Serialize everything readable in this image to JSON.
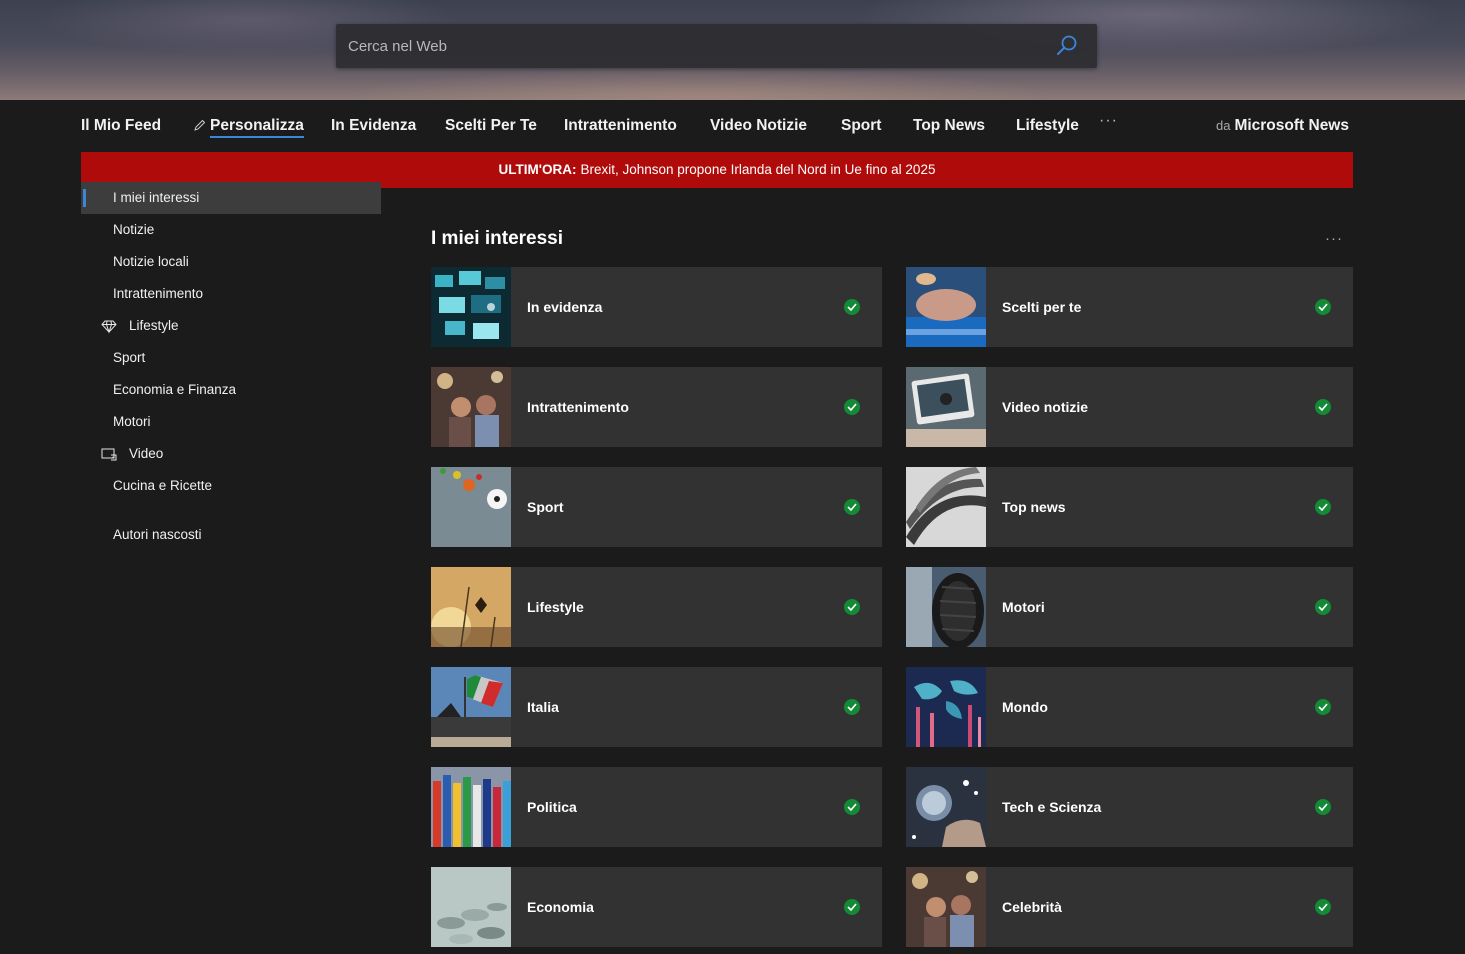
{
  "search": {
    "placeholder": "Cerca nel Web"
  },
  "nav": {
    "items": [
      {
        "label": "Il Mio Feed"
      },
      {
        "label": "Personalizza"
      },
      {
        "label": "In Evidenza"
      },
      {
        "label": "Scelti Per Te"
      },
      {
        "label": "Intrattenimento"
      },
      {
        "label": "Video Notizie"
      },
      {
        "label": "Sport"
      },
      {
        "label": "Top News"
      },
      {
        "label": "Lifestyle"
      }
    ],
    "more": "···",
    "brand_prefix": "da",
    "brand_name": "Microsoft News"
  },
  "breaking": {
    "label": "ULTIM'ORA:",
    "text": "Brexit, Johnson propone Irlanda del Nord in Ue fino al 2025"
  },
  "sidebar": {
    "items": [
      {
        "label": "I miei interessi"
      },
      {
        "label": "Notizie"
      },
      {
        "label": "Notizie locali"
      },
      {
        "label": "Intrattenimento"
      },
      {
        "label": "Lifestyle",
        "icon": "diamond-icon"
      },
      {
        "label": "Sport"
      },
      {
        "label": "Economia e Finanza"
      },
      {
        "label": "Motori"
      },
      {
        "label": "Video",
        "icon": "video-icon"
      },
      {
        "label": "Cucina e Ricette"
      }
    ],
    "hidden_authors": "Autori nascosti"
  },
  "main": {
    "title": "I miei interessi",
    "more": "···",
    "cards": [
      {
        "label": "In evidenza",
        "followed": true
      },
      {
        "label": "Scelti per te",
        "followed": true
      },
      {
        "label": "Intrattenimento",
        "followed": true
      },
      {
        "label": "Video notizie",
        "followed": true
      },
      {
        "label": "Sport",
        "followed": true
      },
      {
        "label": "Top news",
        "followed": true
      },
      {
        "label": "Lifestyle",
        "followed": true
      },
      {
        "label": "Motori",
        "followed": true
      },
      {
        "label": "Italia",
        "followed": true
      },
      {
        "label": "Mondo",
        "followed": true
      },
      {
        "label": "Politica",
        "followed": true
      },
      {
        "label": "Tech e Scienza",
        "followed": true
      },
      {
        "label": "Economia",
        "followed": true
      },
      {
        "label": "Celebrità",
        "followed": true
      }
    ]
  },
  "colors": {
    "accent": "#3a86d8",
    "breaking": "#b00b0b",
    "check": "#138a36",
    "card": "#323232",
    "background": "#1b1b1b"
  }
}
